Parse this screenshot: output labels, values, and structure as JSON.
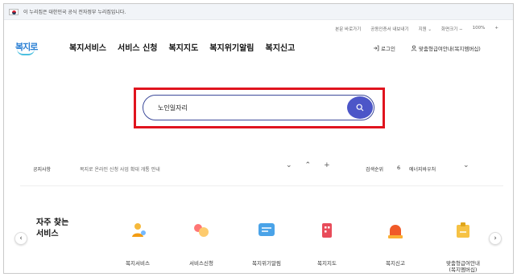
{
  "gov_banner": {
    "text": "이 누리집은 대한민국 공식 전자정부 누리집입니다."
  },
  "util_links": [
    "본문 바로가기",
    "공동인증서 내보내기",
    "지원 ⌄",
    "화면크기 −",
    "100%",
    "+"
  ],
  "logo": {
    "text": "복지로"
  },
  "nav": [
    "복지서비스",
    "서비스 신청",
    "복지지도",
    "복지위기알림",
    "복지신고"
  ],
  "header_actions": {
    "login": "로그인",
    "member": "맞춤형급여안내(복지멤버십)"
  },
  "search": {
    "value": "노인일자리",
    "placeholder": ""
  },
  "notice": {
    "label": "공지사항",
    "text": "복지로 온라인 신청 사업 확대 개통 안내",
    "ctrl_down": "⌄",
    "ctrl_up": "⌃",
    "ctrl_plus": "+"
  },
  "ranking": {
    "label": "검색순위",
    "number": "6",
    "term": "에너지바우처",
    "chevron": "⌄"
  },
  "frequent": {
    "title": "자주 찾는\n서비스",
    "prev": "‹",
    "next": "›",
    "items": [
      {
        "label": "복지서비스",
        "icon": "person-coin-icon"
      },
      {
        "label": "서비스신청",
        "icon": "bubbles-icon"
      },
      {
        "label": "복지위기알림",
        "icon": "message-icon"
      },
      {
        "label": "복지지도",
        "icon": "building-icon"
      },
      {
        "label": "복지신고",
        "icon": "siren-icon"
      },
      {
        "label": "맞춤형급여안내\n(복지멤버십)",
        "icon": "badge-icon"
      }
    ]
  }
}
